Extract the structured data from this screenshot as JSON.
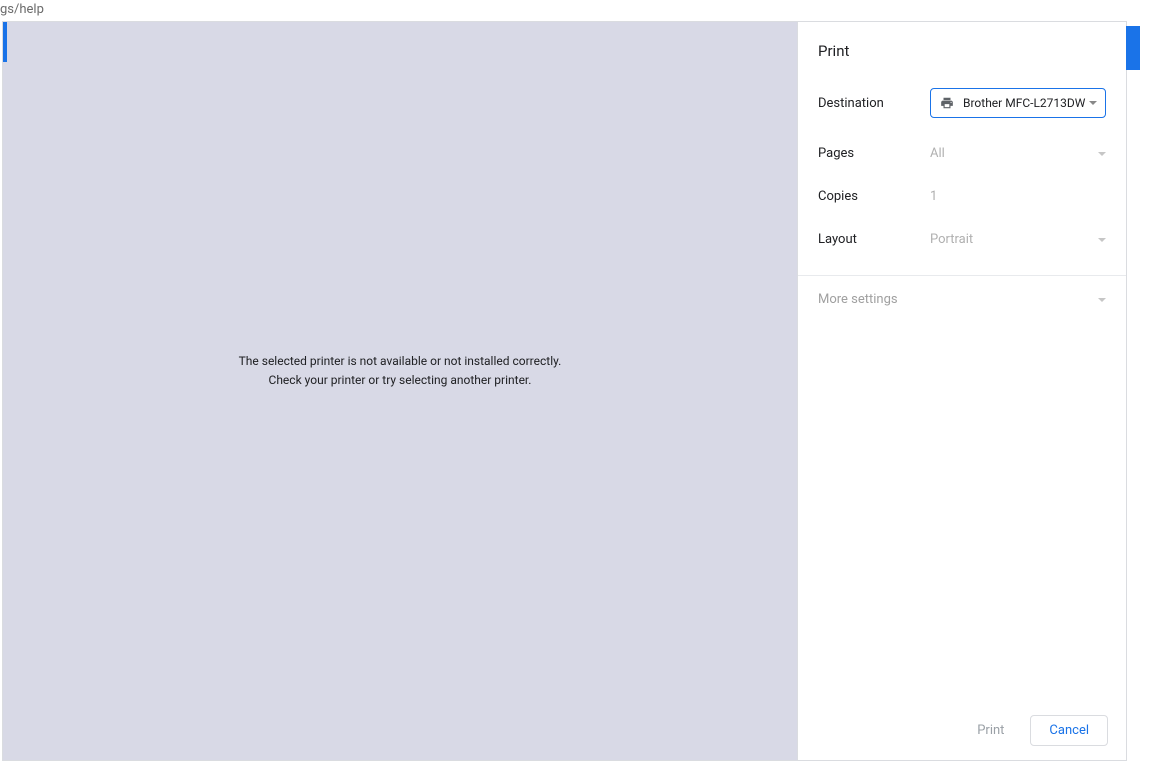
{
  "url_fragment": "gs/help",
  "preview": {
    "line1": "The selected printer is not available or not installed correctly.",
    "line2": "Check your printer or try selecting another printer."
  },
  "panel": {
    "title": "Print",
    "destination": {
      "label": "Destination",
      "value": "Brother MFC-L2713DW"
    },
    "pages": {
      "label": "Pages",
      "value": "All"
    },
    "copies": {
      "label": "Copies",
      "value": "1"
    },
    "layout": {
      "label": "Layout",
      "value": "Portrait"
    },
    "more_settings": "More settings"
  },
  "footer": {
    "print": "Print",
    "cancel": "Cancel"
  }
}
